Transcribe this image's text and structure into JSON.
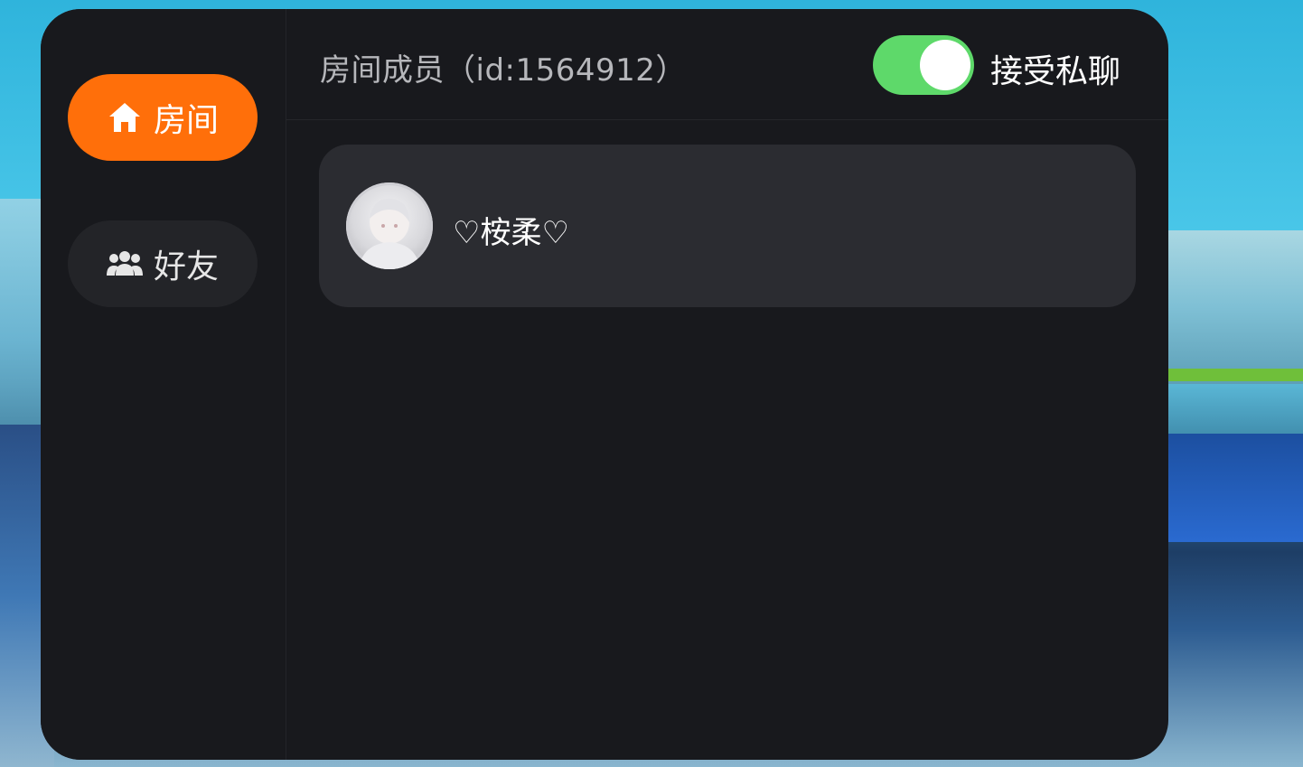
{
  "sidebar": {
    "items": [
      {
        "label": "房间",
        "icon": "home-icon",
        "active": true
      },
      {
        "label": "好友",
        "icon": "friends-icon",
        "active": false
      }
    ]
  },
  "header": {
    "title": "房间成员（id:1564912）",
    "private_chat_toggle": {
      "label": "接受私聊",
      "on": true
    }
  },
  "members": [
    {
      "name": "♡桉柔♡",
      "avatar": "avatar"
    }
  ],
  "colors": {
    "accent": "#ff6f0a",
    "toggle_on": "#5ed96a",
    "panel_bg": "#18191d",
    "card_bg": "#2b2c31"
  }
}
